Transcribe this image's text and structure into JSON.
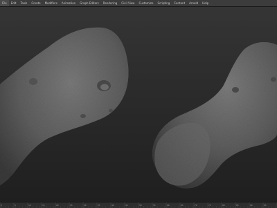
{
  "app": {
    "menu": [
      "File",
      "Edit",
      "Tools",
      "Create",
      "Modifiers",
      "Animation",
      "Graph Editors",
      "Rendering",
      "Civil View",
      "Customize",
      "Scripting",
      "Content",
      "Arnold",
      "Help"
    ]
  },
  "viewport": {
    "label": "",
    "background_top": "#353535",
    "background_bottom": "#1f1f1f",
    "objects": [
      {
        "name": "asteroid-left",
        "material_color": "#6b6b6b"
      },
      {
        "name": "asteroid-right",
        "material_color": "#6e6e6e"
      }
    ]
  },
  "timeline": {
    "ticks": [
      "0",
      "5",
      "10",
      "15",
      "20",
      "25",
      "30",
      "35",
      "40",
      "45",
      "50",
      "55",
      "60",
      "65",
      "70",
      "75",
      "80",
      "85",
      "90",
      "95",
      "100"
    ]
  }
}
